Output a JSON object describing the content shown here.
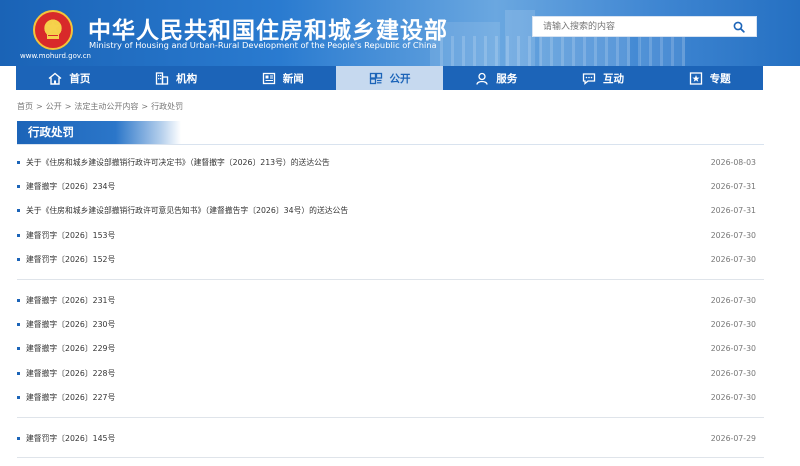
{
  "header": {
    "site_url": "www.mohurd.gov.cn",
    "title": "中华人民共和国住房和城乡建设部",
    "subtitle": "Ministry of Housing and Urban-Rural Development of the People's Republic of China",
    "search_placeholder": "请输入搜索的内容",
    "search_icon": "search-icon"
  },
  "nav": {
    "active_index": 3,
    "items": [
      {
        "label": "首页",
        "icon": "home-icon"
      },
      {
        "label": "机构",
        "icon": "building-icon"
      },
      {
        "label": "新闻",
        "icon": "news-icon"
      },
      {
        "label": "公开",
        "icon": "disclosure-icon"
      },
      {
        "label": "服务",
        "icon": "service-icon"
      },
      {
        "label": "互动",
        "icon": "chat-icon"
      },
      {
        "label": "专题",
        "icon": "star-icon"
      }
    ]
  },
  "breadcrumb": [
    "首页",
    "公开",
    "法定主动公开内容",
    "行政处罚"
  ],
  "breadcrumb_separator": ">",
  "section_title": "行政处罚",
  "colors": {
    "brand_blue": "#1c64b8",
    "active_tab_bg": "#c6d9ef"
  },
  "groups": [
    [
      {
        "title": "关于《住房和城乡建设部撤销行政许可决定书》（建督撤字〔2026〕213号）的送达公告",
        "date": "2026-08-03"
      },
      {
        "title": "建督撤字〔2026〕234号",
        "date": "2026-07-31"
      },
      {
        "title": "关于《住房和城乡建设部撤销行政许可意见告知书》（建督撤告字〔2026〕34号）的送达公告",
        "date": "2026-07-31"
      },
      {
        "title": "建督罚字〔2026〕153号",
        "date": "2026-07-30"
      },
      {
        "title": "建督罚字〔2026〕152号",
        "date": "2026-07-30"
      }
    ],
    [
      {
        "title": "建督撤字〔2026〕231号",
        "date": "2026-07-30"
      },
      {
        "title": "建督撤字〔2026〕230号",
        "date": "2026-07-30"
      },
      {
        "title": "建督撤字〔2026〕229号",
        "date": "2026-07-30"
      },
      {
        "title": "建督撤字〔2026〕228号",
        "date": "2026-07-30"
      },
      {
        "title": "建督撤字〔2026〕227号",
        "date": "2026-07-30"
      }
    ],
    [
      {
        "title": "建督罚字〔2026〕145号",
        "date": "2026-07-29"
      }
    ]
  ]
}
